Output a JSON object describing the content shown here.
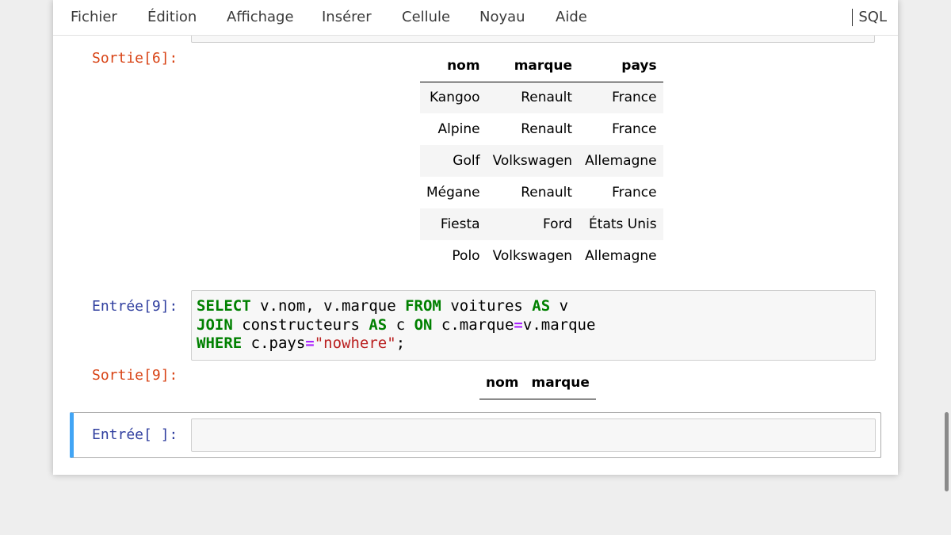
{
  "menu": {
    "items": [
      "Fichier",
      "Édition",
      "Affichage",
      "Insérer",
      "Cellule",
      "Noyau",
      "Aide"
    ],
    "kernel": "SQL"
  },
  "cells": {
    "out6": {
      "prompt": "Sortie[6]:",
      "columns": [
        "nom",
        "marque",
        "pays"
      ],
      "rows": [
        [
          "Kangoo",
          "Renault",
          "France"
        ],
        [
          "Alpine",
          "Renault",
          "France"
        ],
        [
          "Golf",
          "Volkswagen",
          "Allemagne"
        ],
        [
          "Mégane",
          "Renault",
          "France"
        ],
        [
          "Fiesta",
          "Ford",
          "États Unis"
        ],
        [
          "Polo",
          "Volkswagen",
          "Allemagne"
        ]
      ]
    },
    "in9": {
      "prompt": "Entrée[9]:",
      "code": {
        "l1_kw1": "SELECT",
        "l1_t1": " v.nom, v.marque ",
        "l1_kw2": "FROM",
        "l1_t2": " voitures ",
        "l1_kw3": "AS",
        "l1_t3": " v",
        "l2_kw1": "JOIN",
        "l2_t1": " constructeurs ",
        "l2_kw2": "AS",
        "l2_t2": " c ",
        "l2_kw3": "ON",
        "l2_t3": " c.marque",
        "l2_op": "=",
        "l2_t4": "v.marque",
        "l3_kw1": "WHERE",
        "l3_t1": " c.pays",
        "l3_op": "=",
        "l3_str": "\"nowhere\"",
        "l3_t2": ";"
      }
    },
    "out9": {
      "prompt": "Sortie[9]:",
      "columns": [
        "nom",
        "marque"
      ]
    },
    "in_empty": {
      "prompt": "Entrée[ ]:"
    }
  }
}
